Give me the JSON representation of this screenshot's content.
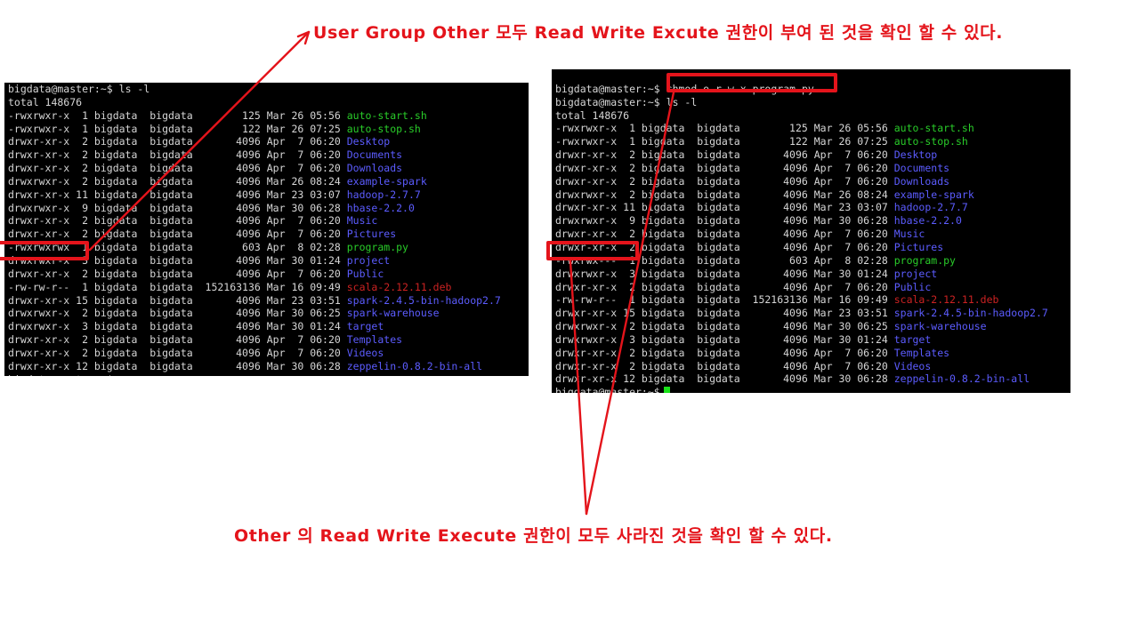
{
  "annotations": {
    "top": "User Group Other 모두 Read Write Excute 권한이 부여 된 것을 확인 할 수 있다.",
    "bottom": "Other 의 Read Write Execute 권한이 모두 사라진 것을 확인 할 수 있다.",
    "color": "#e4141b"
  },
  "highlight_color": "#e4141b",
  "terminal_left": {
    "prompt": "bigdata@master:~$",
    "command": "ls -l",
    "total": "total 148676",
    "rows": [
      {
        "perm": "-rwxrwxr-x",
        "links": "1",
        "owner": "bigdata",
        "group": "bigdata",
        "size": "125",
        "month": "Mar",
        "day": "26",
        "time": "05:56",
        "name": "auto-start.sh",
        "kind": "exec"
      },
      {
        "perm": "-rwxrwxr-x",
        "links": "1",
        "owner": "bigdata",
        "group": "bigdata",
        "size": "122",
        "month": "Mar",
        "day": "26",
        "time": "07:25",
        "name": "auto-stop.sh",
        "kind": "exec"
      },
      {
        "perm": "drwxr-xr-x",
        "links": "2",
        "owner": "bigdata",
        "group": "bigdata",
        "size": "4096",
        "month": "Apr",
        "day": "7",
        "time": "06:20",
        "name": "Desktop",
        "kind": "dir"
      },
      {
        "perm": "drwxr-xr-x",
        "links": "2",
        "owner": "bigdata",
        "group": "bigdata",
        "size": "4096",
        "month": "Apr",
        "day": "7",
        "time": "06:20",
        "name": "Documents",
        "kind": "dir"
      },
      {
        "perm": "drwxr-xr-x",
        "links": "2",
        "owner": "bigdata",
        "group": "bigdata",
        "size": "4096",
        "month": "Apr",
        "day": "7",
        "time": "06:20",
        "name": "Downloads",
        "kind": "dir"
      },
      {
        "perm": "drwxrwxr-x",
        "links": "2",
        "owner": "bigdata",
        "group": "bigdata",
        "size": "4096",
        "month": "Mar",
        "day": "26",
        "time": "08:24",
        "name": "example-spark",
        "kind": "dir"
      },
      {
        "perm": "drwxr-xr-x",
        "links": "11",
        "owner": "bigdata",
        "group": "bigdata",
        "size": "4096",
        "month": "Mar",
        "day": "23",
        "time": "03:07",
        "name": "hadoop-2.7.7",
        "kind": "dir"
      },
      {
        "perm": "drwxrwxr-x",
        "links": "9",
        "owner": "bigdata",
        "group": "bigdata",
        "size": "4096",
        "month": "Mar",
        "day": "30",
        "time": "06:28",
        "name": "hbase-2.2.0",
        "kind": "dir"
      },
      {
        "perm": "drwxr-xr-x",
        "links": "2",
        "owner": "bigdata",
        "group": "bigdata",
        "size": "4096",
        "month": "Apr",
        "day": "7",
        "time": "06:20",
        "name": "Music",
        "kind": "dir"
      },
      {
        "perm": "drwxr-xr-x",
        "links": "2",
        "owner": "bigdata",
        "group": "bigdata",
        "size": "4096",
        "month": "Apr",
        "day": "7",
        "time": "06:20",
        "name": "Pictures",
        "kind": "dir"
      },
      {
        "perm": "-rwxrwxrwx",
        "links": "1",
        "owner": "bigdata",
        "group": "bigdata",
        "size": "603",
        "month": "Apr",
        "day": "8",
        "time": "02:28",
        "name": "program.py",
        "kind": "exec"
      },
      {
        "perm": "drwxrwxr-x",
        "links": "3",
        "owner": "bigdata",
        "group": "bigdata",
        "size": "4096",
        "month": "Mar",
        "day": "30",
        "time": "01:24",
        "name": "project",
        "kind": "dir"
      },
      {
        "perm": "drwxr-xr-x",
        "links": "2",
        "owner": "bigdata",
        "group": "bigdata",
        "size": "4096",
        "month": "Apr",
        "day": "7",
        "time": "06:20",
        "name": "Public",
        "kind": "dir"
      },
      {
        "perm": "-rw-rw-r--",
        "links": "1",
        "owner": "bigdata",
        "group": "bigdata",
        "size": "152163136",
        "month": "Mar",
        "day": "16",
        "time": "09:49",
        "name": "scala-2.12.11.deb",
        "kind": "arch"
      },
      {
        "perm": "drwxr-xr-x",
        "links": "15",
        "owner": "bigdata",
        "group": "bigdata",
        "size": "4096",
        "month": "Mar",
        "day": "23",
        "time": "03:51",
        "name": "spark-2.4.5-bin-hadoop2.7",
        "kind": "dir"
      },
      {
        "perm": "drwxrwxr-x",
        "links": "2",
        "owner": "bigdata",
        "group": "bigdata",
        "size": "4096",
        "month": "Mar",
        "day": "30",
        "time": "06:25",
        "name": "spark-warehouse",
        "kind": "dir"
      },
      {
        "perm": "drwxrwxr-x",
        "links": "3",
        "owner": "bigdata",
        "group": "bigdata",
        "size": "4096",
        "month": "Mar",
        "day": "30",
        "time": "01:24",
        "name": "target",
        "kind": "dir"
      },
      {
        "perm": "drwxr-xr-x",
        "links": "2",
        "owner": "bigdata",
        "group": "bigdata",
        "size": "4096",
        "month": "Apr",
        "day": "7",
        "time": "06:20",
        "name": "Templates",
        "kind": "dir"
      },
      {
        "perm": "drwxr-xr-x",
        "links": "2",
        "owner": "bigdata",
        "group": "bigdata",
        "size": "4096",
        "month": "Apr",
        "day": "7",
        "time": "06:20",
        "name": "Videos",
        "kind": "dir"
      },
      {
        "perm": "drwxr-xr-x",
        "links": "12",
        "owner": "bigdata",
        "group": "bigdata",
        "size": "4096",
        "month": "Mar",
        "day": "30",
        "time": "06:28",
        "name": "zeppelin-0.8.2-bin-all",
        "kind": "dir"
      }
    ],
    "highlighted_perm": "-rwxrwxrwx"
  },
  "terminal_right": {
    "prompt": "bigdata@master:~$",
    "command_chmod": "chmod o-r-w-x program.py",
    "command_ls": "ls -l",
    "total": "total 148676",
    "rows": [
      {
        "perm": "-rwxrwxr-x",
        "links": "1",
        "owner": "bigdata",
        "group": "bigdata",
        "size": "125",
        "month": "Mar",
        "day": "26",
        "time": "05:56",
        "name": "auto-start.sh",
        "kind": "exec"
      },
      {
        "perm": "-rwxrwxr-x",
        "links": "1",
        "owner": "bigdata",
        "group": "bigdata",
        "size": "122",
        "month": "Mar",
        "day": "26",
        "time": "07:25",
        "name": "auto-stop.sh",
        "kind": "exec"
      },
      {
        "perm": "drwxr-xr-x",
        "links": "2",
        "owner": "bigdata",
        "group": "bigdata",
        "size": "4096",
        "month": "Apr",
        "day": "7",
        "time": "06:20",
        "name": "Desktop",
        "kind": "dir"
      },
      {
        "perm": "drwxr-xr-x",
        "links": "2",
        "owner": "bigdata",
        "group": "bigdata",
        "size": "4096",
        "month": "Apr",
        "day": "7",
        "time": "06:20",
        "name": "Documents",
        "kind": "dir"
      },
      {
        "perm": "drwxr-xr-x",
        "links": "2",
        "owner": "bigdata",
        "group": "bigdata",
        "size": "4096",
        "month": "Apr",
        "day": "7",
        "time": "06:20",
        "name": "Downloads",
        "kind": "dir"
      },
      {
        "perm": "drwxrwxr-x",
        "links": "2",
        "owner": "bigdata",
        "group": "bigdata",
        "size": "4096",
        "month": "Mar",
        "day": "26",
        "time": "08:24",
        "name": "example-spark",
        "kind": "dir"
      },
      {
        "perm": "drwxr-xr-x",
        "links": "11",
        "owner": "bigdata",
        "group": "bigdata",
        "size": "4096",
        "month": "Mar",
        "day": "23",
        "time": "03:07",
        "name": "hadoop-2.7.7",
        "kind": "dir"
      },
      {
        "perm": "drwxrwxr-x",
        "links": "9",
        "owner": "bigdata",
        "group": "bigdata",
        "size": "4096",
        "month": "Mar",
        "day": "30",
        "time": "06:28",
        "name": "hbase-2.2.0",
        "kind": "dir"
      },
      {
        "perm": "drwxr-xr-x",
        "links": "2",
        "owner": "bigdata",
        "group": "bigdata",
        "size": "4096",
        "month": "Apr",
        "day": "7",
        "time": "06:20",
        "name": "Music",
        "kind": "dir"
      },
      {
        "perm": "drwxr-xr-x",
        "links": "2",
        "owner": "bigdata",
        "group": "bigdata",
        "size": "4096",
        "month": "Apr",
        "day": "7",
        "time": "06:20",
        "name": "Pictures",
        "kind": "dir"
      },
      {
        "perm": "-rwxrwx---",
        "links": "1",
        "owner": "bigdata",
        "group": "bigdata",
        "size": "603",
        "month": "Apr",
        "day": "8",
        "time": "02:28",
        "name": "program.py",
        "kind": "exec"
      },
      {
        "perm": "drwxrwxr-x",
        "links": "3",
        "owner": "bigdata",
        "group": "bigdata",
        "size": "4096",
        "month": "Mar",
        "day": "30",
        "time": "01:24",
        "name": "project",
        "kind": "dir"
      },
      {
        "perm": "drwxr-xr-x",
        "links": "2",
        "owner": "bigdata",
        "group": "bigdata",
        "size": "4096",
        "month": "Apr",
        "day": "7",
        "time": "06:20",
        "name": "Public",
        "kind": "dir"
      },
      {
        "perm": "-rw-rw-r--",
        "links": "1",
        "owner": "bigdata",
        "group": "bigdata",
        "size": "152163136",
        "month": "Mar",
        "day": "16",
        "time": "09:49",
        "name": "scala-2.12.11.deb",
        "kind": "arch"
      },
      {
        "perm": "drwxr-xr-x",
        "links": "15",
        "owner": "bigdata",
        "group": "bigdata",
        "size": "4096",
        "month": "Mar",
        "day": "23",
        "time": "03:51",
        "name": "spark-2.4.5-bin-hadoop2.7",
        "kind": "dir"
      },
      {
        "perm": "drwxrwxr-x",
        "links": "2",
        "owner": "bigdata",
        "group": "bigdata",
        "size": "4096",
        "month": "Mar",
        "day": "30",
        "time": "06:25",
        "name": "spark-warehouse",
        "kind": "dir"
      },
      {
        "perm": "drwxrwxr-x",
        "links": "3",
        "owner": "bigdata",
        "group": "bigdata",
        "size": "4096",
        "month": "Mar",
        "day": "30",
        "time": "01:24",
        "name": "target",
        "kind": "dir"
      },
      {
        "perm": "drwxr-xr-x",
        "links": "2",
        "owner": "bigdata",
        "group": "bigdata",
        "size": "4096",
        "month": "Apr",
        "day": "7",
        "time": "06:20",
        "name": "Templates",
        "kind": "dir"
      },
      {
        "perm": "drwxr-xr-x",
        "links": "2",
        "owner": "bigdata",
        "group": "bigdata",
        "size": "4096",
        "month": "Apr",
        "day": "7",
        "time": "06:20",
        "name": "Videos",
        "kind": "dir"
      },
      {
        "perm": "drwxr-xr-x",
        "links": "12",
        "owner": "bigdata",
        "group": "bigdata",
        "size": "4096",
        "month": "Mar",
        "day": "30",
        "time": "06:28",
        "name": "zeppelin-0.8.2-bin-all",
        "kind": "dir"
      }
    ],
    "highlighted_perm": "-rwxrwx---"
  }
}
